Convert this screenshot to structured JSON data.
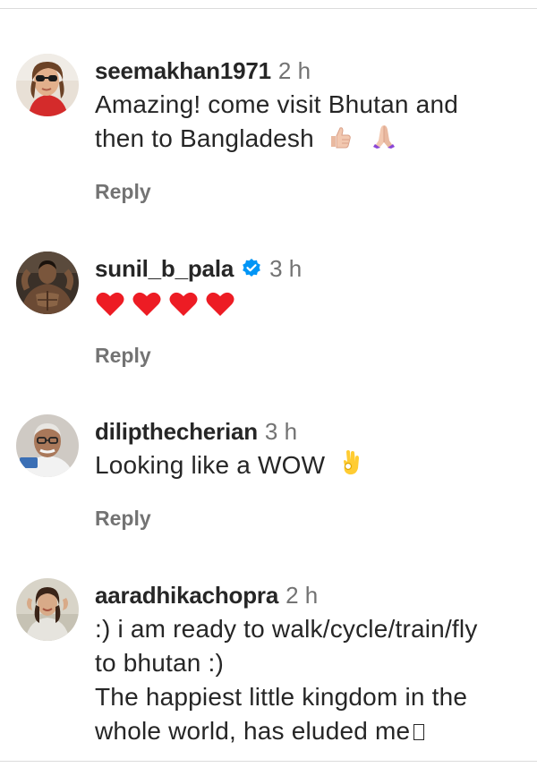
{
  "comments": [
    {
      "username": "seemakhan1971",
      "time": "2 h",
      "lines": [
        "Amazing! come visit Bhutan and",
        "then to Bangladesh"
      ],
      "emojis": [
        "thumbs-up-emoji",
        "folded-hands-emoji"
      ],
      "reply": "Reply"
    },
    {
      "username": "sunil_b_pala",
      "verified": true,
      "time": "3 h",
      "emojis": [
        "red-heart-emoji",
        "red-heart-emoji",
        "red-heart-emoji",
        "red-heart-emoji"
      ],
      "reply": "Reply"
    },
    {
      "username": "dilipthecherian",
      "time": "3 h",
      "lines": [
        "Looking like a WOW"
      ],
      "emojis": [
        "ok-hand-emoji"
      ],
      "reply": "Reply"
    },
    {
      "username": "aaradhikachopra",
      "time": "2 h",
      "lines": [
        ":) i am ready to walk/cycle/train/fly",
        "to bhutan :)",
        "The happiest little kingdom in the",
        "whole world, has eluded me"
      ],
      "emojis": [
        "missing-glyph-box"
      ]
    }
  ],
  "colors": {
    "text": "#262626",
    "secondary": "#737373",
    "verified": "#0095f6",
    "heart": "#ed1c24"
  }
}
